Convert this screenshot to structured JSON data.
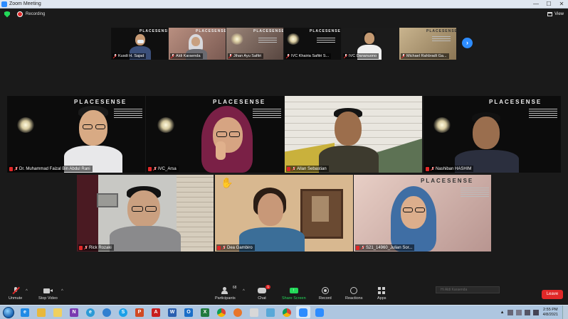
{
  "window": {
    "title": "Zoom Meeting",
    "minimize": "—",
    "maximize": "☐",
    "close": "✕"
  },
  "topbar": {
    "recording_label": "Recording",
    "view_label": "View"
  },
  "thumbnails": [
    {
      "name": "Kusdi H. Sajad"
    },
    {
      "name": "Aldi Karaenda"
    },
    {
      "name": "Jihan Ayu Safitri"
    },
    {
      "name": "IVC Khairia Safitri S..."
    },
    {
      "name": "IVC Dananuono"
    },
    {
      "name": "Michael Rahbradt Ga..."
    }
  ],
  "tiles": [
    {
      "name": "Dr. Muhammad Faizal Bin Abdul Rani"
    },
    {
      "name": "IVC_Arsa"
    },
    {
      "name": "Allan Sebastian"
    },
    {
      "name": "Nashiban HASHIM"
    },
    {
      "name": "Rick Rozaki"
    },
    {
      "name": "Dea Gambiro"
    },
    {
      "name": "S21_14960_Julian Sor..."
    }
  ],
  "poster": {
    "brand": "PLACESENSE"
  },
  "toolbar": {
    "unmute": "Unmute",
    "stop_video": "Stop Video",
    "participants": "Participants",
    "participants_count": "68",
    "chat": "Chat",
    "chat_badge": "1",
    "share_screen": "Share Screen",
    "record": "Record",
    "reactions": "Reactions",
    "apps": "Apps",
    "leave": "Leave",
    "speaker_hint": "Hi Aldi Karaenda"
  },
  "taskbar": {
    "time": "2:55 PM",
    "date": "4/8/2021"
  },
  "colors": {
    "accent": "#2d8cff",
    "danger": "#e02828",
    "share_green": "#23d959"
  }
}
